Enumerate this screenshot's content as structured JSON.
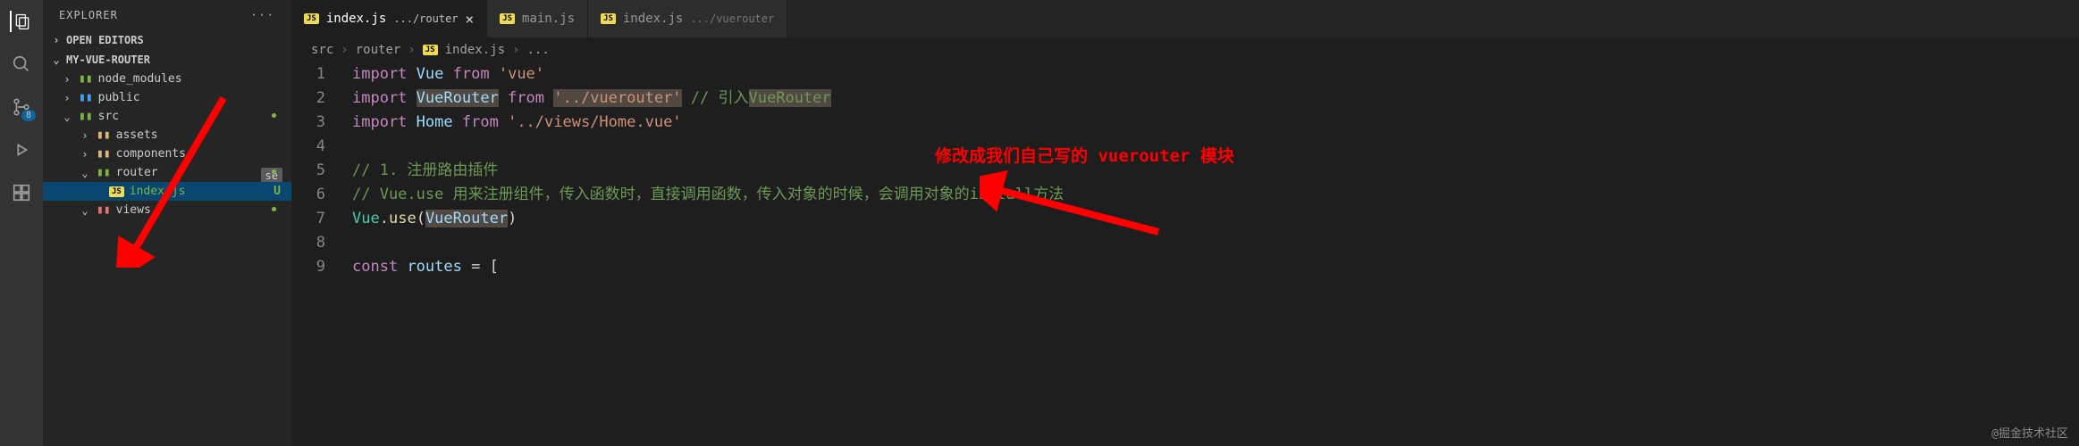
{
  "activityBar": {
    "badge": "8"
  },
  "sidebar": {
    "title": "EXPLORER",
    "sections": {
      "openEditors": "OPEN EDITORS",
      "project": "MY-VUE-ROUTER"
    },
    "items": {
      "node_modules": "node_modules",
      "public": "public",
      "src": "src",
      "assets": "assets",
      "components": "components",
      "router": "router",
      "index_js": "index.js",
      "views": "views"
    },
    "git_u": "U",
    "se": "se"
  },
  "tabs": [
    {
      "icon": "JS",
      "label": "index.js",
      "hint": ".../router",
      "active": true,
      "closable": true
    },
    {
      "icon": "JS",
      "label": "main.js",
      "hint": "",
      "active": false,
      "closable": false
    },
    {
      "icon": "JS",
      "label": "index.js",
      "hint": ".../vuerouter",
      "active": false,
      "closable": false
    }
  ],
  "breadcrumb": {
    "part1": "src",
    "part2": "router",
    "part3": "index.js",
    "part4": "..."
  },
  "code": {
    "lines": [
      "1",
      "2",
      "3",
      "4",
      "5",
      "6",
      "7",
      "8",
      "9"
    ],
    "l1_import": "import",
    "l1_vue": "Vue",
    "l1_from": "from",
    "l1_str": "'vue'",
    "l2_import": "import",
    "l2_vr": "VueRouter",
    "l2_from": "from",
    "l2_str": "'../vuerouter'",
    "l2_cmt": "// 引入",
    "l2_cmt2": "VueRouter",
    "l3_import": "import",
    "l3_home": "Home",
    "l3_from": "from",
    "l3_str": "'../views/Home.vue'",
    "l5_cmt": "// 1. 注册路由插件",
    "l6_cmt": "// Vue.use 用来注册组件，传入函数时，直接调用函数，传入对象的时候，会调用对象的install方法",
    "l7_vue": "Vue",
    "l7_use": "use",
    "l7_vr": "VueRouter",
    "l9_const": "const",
    "l9_routes": "routes",
    "l9_eq": "= ["
  },
  "annotation": "修改成我们自己写的 vuerouter 模块",
  "watermark": "@掘金技术社区"
}
